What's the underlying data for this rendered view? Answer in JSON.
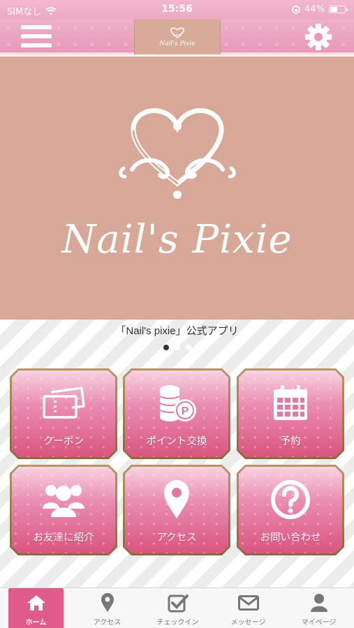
{
  "status_bar": {
    "carrier": "SIMなし",
    "time": "15:56",
    "battery": "44%",
    "battery_level": 0.44
  },
  "header": {
    "logo_text": "Nail's Pixie"
  },
  "banner": {
    "brand_text": "Nail's Pixie"
  },
  "main": {
    "app_title": "「Nail's pixie」公式アプリ",
    "carousel": {
      "count": 3,
      "active_index": 0
    },
    "tiles": [
      {
        "label": "クーポン",
        "icon": "ticket-icon"
      },
      {
        "label": "ポイント交換",
        "icon": "coins-icon"
      },
      {
        "label": "予約",
        "icon": "calendar-icon"
      },
      {
        "label": "お友達に紹介",
        "icon": "people-icon"
      },
      {
        "label": "アクセス",
        "icon": "map-pin-icon"
      },
      {
        "label": "お問い合わせ",
        "icon": "question-icon"
      }
    ]
  },
  "tabbar": {
    "tabs": [
      {
        "label": "ホーム",
        "icon": "home-icon",
        "active": true
      },
      {
        "label": "アクセス",
        "icon": "location-icon",
        "active": false
      },
      {
        "label": "チェックイン",
        "icon": "checkbox-icon",
        "active": false
      },
      {
        "label": "メッセージ",
        "icon": "envelope-icon",
        "active": false
      },
      {
        "label": "マイページ",
        "icon": "person-icon",
        "active": false
      }
    ]
  },
  "colors": {
    "header_pink": "#e79ab8",
    "banner_tan": "#d7a897",
    "tile_pink": "#d9557f",
    "tab_active": "#e05a8a",
    "tile_frame": "#8b6a3e"
  }
}
